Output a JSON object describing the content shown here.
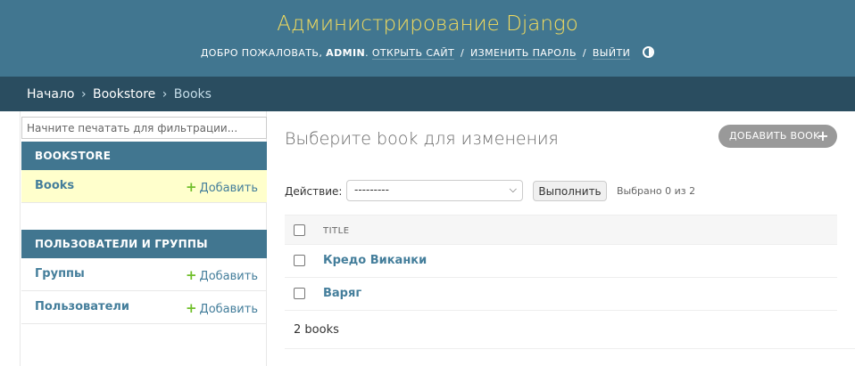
{
  "header": {
    "site_title": "Администрирование Django",
    "welcome": "Добро пожаловать,",
    "username": "admin",
    "view_site": "Открыть сайт",
    "change_password": "Изменить пароль",
    "logout": "Выйти",
    "separator": "/",
    "theme_icon": "theme-toggle-icon"
  },
  "breadcrumbs": {
    "home": "Начало",
    "app": "Bookstore",
    "current": "Books",
    "chevron": "›"
  },
  "sidebar": {
    "filter_placeholder": "Начните печатать для фильтрации...",
    "modules": [
      {
        "caption": "Bookstore",
        "models": [
          {
            "name": "Books",
            "add_label": "Добавить",
            "current": true
          }
        ]
      },
      {
        "caption": "Пользователи и группы",
        "models": [
          {
            "name": "Группы",
            "add_label": "Добавить"
          },
          {
            "name": "Пользователи",
            "add_label": "Добавить"
          }
        ]
      }
    ]
  },
  "main": {
    "title": "Выберите book для изменения",
    "add_button": "Добавить book",
    "actions": {
      "label": "Действие:",
      "selected": "---------",
      "go_button": "Выполнить",
      "counter": "Выбрано 0 из 2"
    },
    "table": {
      "columns": [
        "Title"
      ],
      "rows": [
        {
          "title": "Кредо Виканки"
        },
        {
          "title": "Варяг"
        }
      ]
    },
    "paginator": "2 books"
  },
  "colors": {
    "header_bg": "#417690",
    "breadcrumbs_bg": "#2a4d60",
    "site_title": "#f5dd5d",
    "link": "#447e9b",
    "add_plus": "#70bf2b",
    "current_row": "#ffffcc"
  }
}
